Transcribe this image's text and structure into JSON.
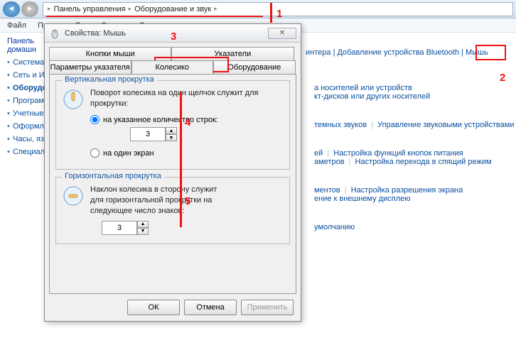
{
  "breadcrumb": {
    "item1": "Панель управления",
    "item2": "Оборудование и звук",
    "sep": "▸"
  },
  "menu": {
    "file": "Файл",
    "edit": "Правка",
    "view": "Вид",
    "tools": "Сервис",
    "help": "Справка"
  },
  "sidebar": {
    "home": "Панель\nдомашн",
    "items": [
      "Система",
      "Сеть и И",
      "Оборудо",
      "Програм",
      "Учетные\nпользов\nбезопас",
      "Оформл",
      "Часы, яз",
      "Специал"
    ],
    "bold_index": 2
  },
  "main": {
    "row1": {
      "a": "интера",
      "b": "Добавление устройства Bluetooth",
      "c": "Мышь"
    },
    "row2": {
      "a": "а носителей или устройств",
      "b": "кт-дисков или других носителей"
    },
    "row3": {
      "a": "темных звуков",
      "b": "Управление звуковыми устройствами"
    },
    "row4": {
      "a": "ей",
      "b": "Настройка функций кнопок питания",
      "c": "аметров",
      "d": "Настройка перехода в спящий режим"
    },
    "row5": {
      "a": "ментов",
      "b": "Настройка разрешения экрана",
      "c": "ение к внешнему дисплею"
    },
    "row6": {
      "a": "умолчанию"
    }
  },
  "dialog": {
    "title": "Свойства: Мышь",
    "tabs": {
      "r1a": "Кнопки мыши",
      "r1b": "Указатели",
      "r2a": "Параметры указателя",
      "r2b": "Колесико",
      "r2c": "Оборудование"
    },
    "group1": {
      "title": "Вертикальная прокрутка",
      "desc": "Поворот колесика на один щелчок служит для прокрутки:",
      "radio1": "на указанное количество строк:",
      "radio2": "на один экран",
      "value": "3"
    },
    "group2": {
      "title": "Горизонтальная прокрутка",
      "desc": "Наклон колесика в сторону служит для горизонтальной прокрутки на следующее число знаков:",
      "value": "3"
    },
    "buttons": {
      "ok": "ОК",
      "cancel": "Отмена",
      "apply": "Применить"
    },
    "close_glyph": "✕"
  },
  "annotations": {
    "n1": "1",
    "n2": "2",
    "n3": "3",
    "n4": "4",
    "n5": "5"
  }
}
